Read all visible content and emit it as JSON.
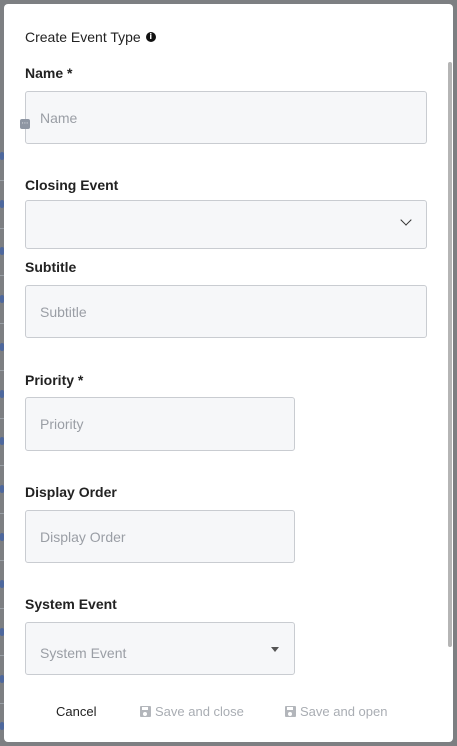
{
  "dialog": {
    "title": "Create Event Type",
    "info_icon": "info-icon"
  },
  "form": {
    "name": {
      "label": "Name *",
      "placeholder": "Name",
      "value": ""
    },
    "closing_event": {
      "label": "Closing Event",
      "value": ""
    },
    "subtitle": {
      "label": "Subtitle",
      "placeholder": "Subtitle",
      "value": ""
    },
    "priority": {
      "label": "Priority *",
      "placeholder": "Priority",
      "value": ""
    },
    "display_order": {
      "label": "Display Order",
      "placeholder": "Display Order",
      "value": ""
    },
    "system_event": {
      "label": "System Event",
      "placeholder": "System Event"
    }
  },
  "footer": {
    "cancel_label": "Cancel",
    "save_close_label": "Save and close",
    "save_open_label": "Save and open"
  },
  "colors": {
    "field_bg": "#f6f7f9",
    "field_border": "#c9ccd1",
    "disabled_text": "#a9adb3"
  }
}
